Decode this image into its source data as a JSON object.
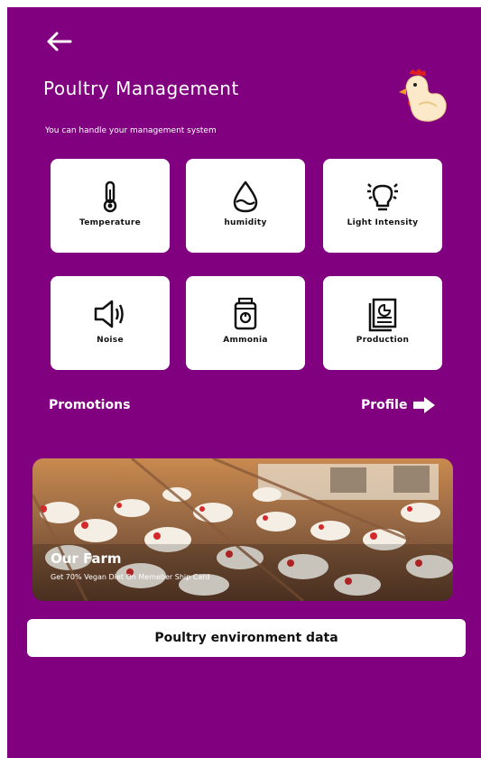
{
  "header": {
    "title": "Poultry Management",
    "subtitle": "You can handle your management system"
  },
  "tiles": [
    {
      "label": "Temperature",
      "icon": "thermometer-icon"
    },
    {
      "label": "humidity",
      "icon": "water-drop-icon"
    },
    {
      "label": "Light Intensity",
      "icon": "lightbulb-icon"
    },
    {
      "label": "Noise",
      "icon": "speaker-icon"
    },
    {
      "label": "Ammonia",
      "icon": "ammonia-sensor-icon"
    },
    {
      "label": "Production",
      "icon": "report-icon"
    }
  ],
  "links": {
    "promotions": "Promotions",
    "profile": "Profile"
  },
  "banner": {
    "title": "Our Farm",
    "text": "Get 70% Vegan Diet On Memeber Ship Card"
  },
  "action_button": "Poultry environment data",
  "colors": {
    "background": "#800080",
    "card": "#ffffff"
  }
}
